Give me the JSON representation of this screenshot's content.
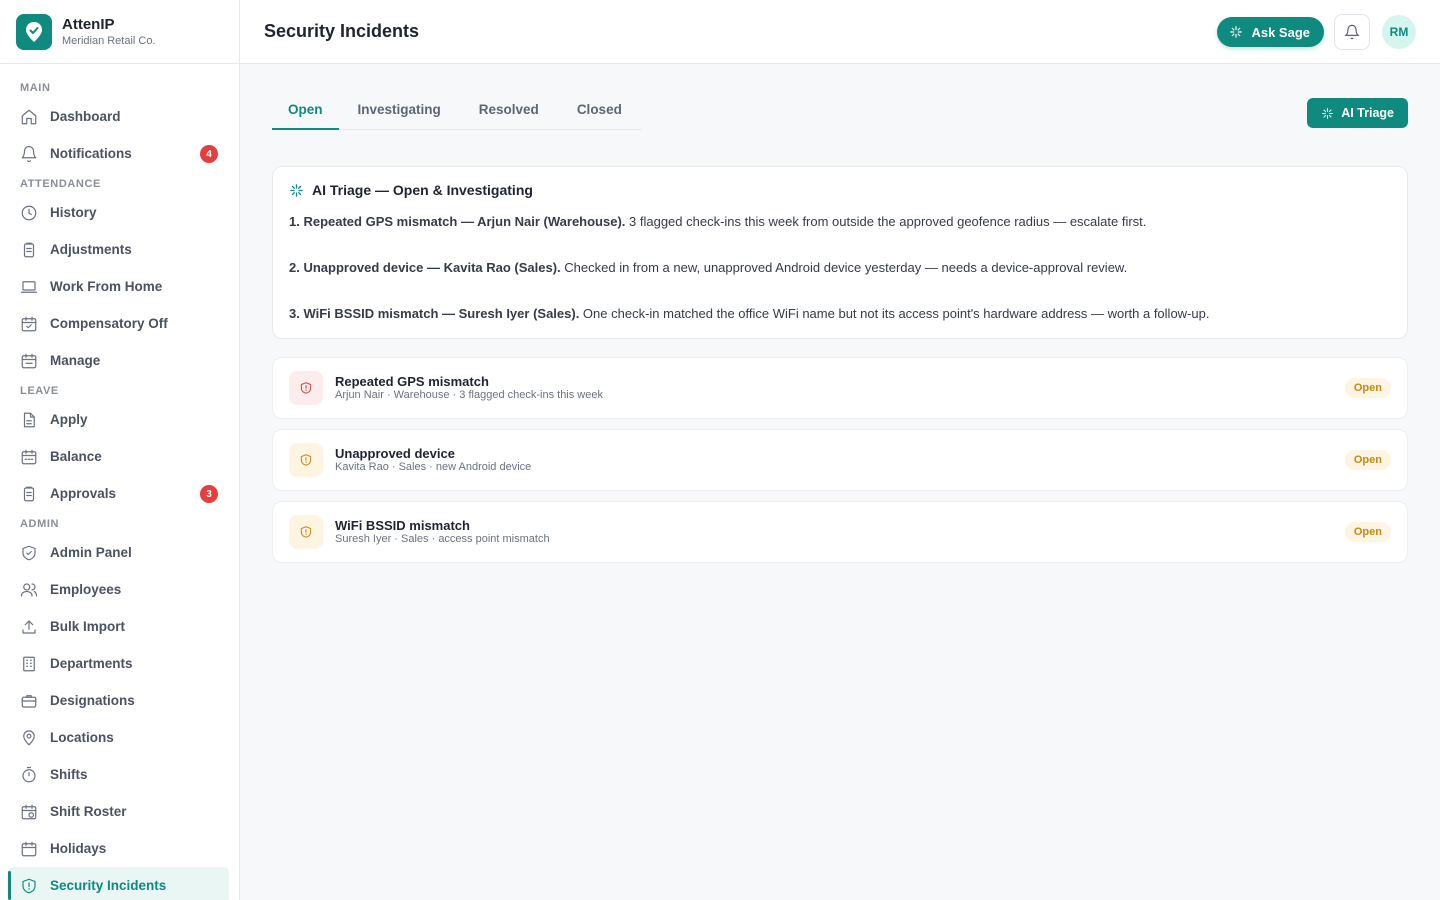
{
  "brand": {
    "name": "AttenIP",
    "org": "Meridian Retail Co."
  },
  "sidebar": {
    "sections": {
      "main": "MAIN",
      "attendance": "ATTENDANCE",
      "leave": "LEAVE",
      "admin": "ADMIN"
    },
    "items": {
      "dashboard": "Dashboard",
      "notifications": "Notifications",
      "notifications_badge": "4",
      "history": "History",
      "adjustments": "Adjustments",
      "work_from_home": "Work From Home",
      "compensatory_off": "Compensatory Off",
      "manage": "Manage",
      "apply": "Apply",
      "balance": "Balance",
      "approvals": "Approvals",
      "approvals_badge": "3",
      "admin_panel": "Admin Panel",
      "employees": "Employees",
      "bulk_import": "Bulk Import",
      "departments": "Departments",
      "designations": "Designations",
      "locations": "Locations",
      "shifts": "Shifts",
      "shift_roster": "Shift Roster",
      "holidays": "Holidays",
      "security_incidents": "Security Incidents"
    }
  },
  "header": {
    "title": "Security Incidents",
    "ask_sage": "Ask Sage",
    "avatar_initials": "RM"
  },
  "tabs": [
    "Open",
    "Investigating",
    "Resolved",
    "Closed"
  ],
  "ai_triage_button": "AI Triage",
  "triage": {
    "title": "AI Triage — Open & Investigating",
    "items": [
      {
        "bold": "1. Repeated GPS mismatch — Arjun Nair (Warehouse).",
        "text": " 3 flagged check-ins this week from outside the approved geofence radius — escalate first."
      },
      {
        "bold": "2. Unapproved device — Kavita Rao (Sales).",
        "text": " Checked in from a new, unapproved Android device yesterday — needs a device-approval review."
      },
      {
        "bold": "3. WiFi BSSID mismatch — Suresh Iyer (Sales).",
        "text": " One check-in matched the office WiFi name but not its access point's hardware address — worth a follow-up."
      }
    ]
  },
  "incidents": [
    {
      "title": "Repeated GPS mismatch",
      "sub": "Arjun Nair · Warehouse · 3 flagged check-ins this week",
      "status": "Open",
      "severity": "red"
    },
    {
      "title": "Unapproved device",
      "sub": "Kavita Rao · Sales · new Android device",
      "status": "Open",
      "severity": "amber"
    },
    {
      "title": "WiFi BSSID mismatch",
      "sub": "Suresh Iyer · Sales · access point mismatch",
      "status": "Open",
      "severity": "amber"
    }
  ],
  "colors": {
    "accent": "#0f8a7e",
    "badge": "#e53e3e",
    "danger": "#d64545",
    "warning": "#c78a16"
  }
}
